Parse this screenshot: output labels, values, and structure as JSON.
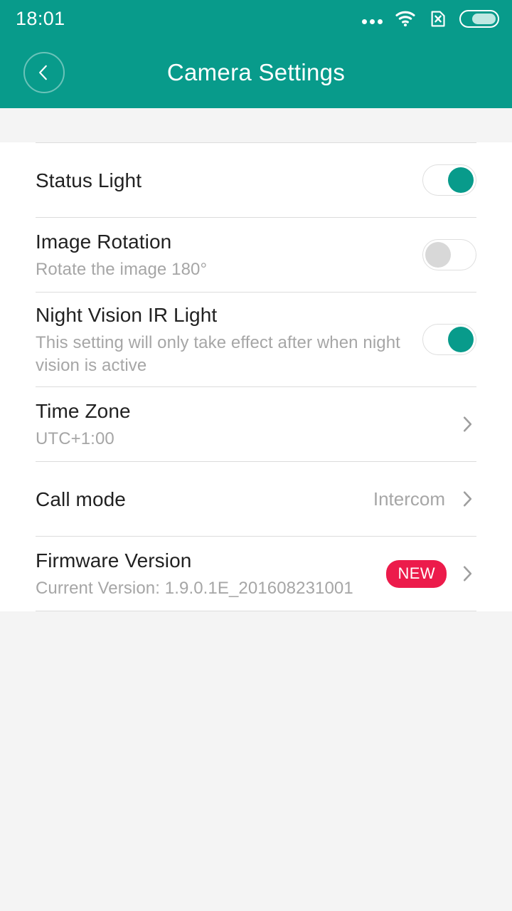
{
  "theme": {
    "accent": "#089b8b",
    "badge_color": "#ec1b4b",
    "page_bg": "#f4f4f4",
    "card_bg": "#ffffff"
  },
  "status_bar": {
    "time": "18:01",
    "icons": [
      "more-dots-icon",
      "wifi-icon",
      "sim-card-off-icon",
      "battery-icon"
    ],
    "battery_level_pct": 72
  },
  "app_bar": {
    "back_icon": "chevron-left-icon",
    "title": "Camera Settings"
  },
  "settings": {
    "rows": [
      {
        "id": "status-light",
        "title": "Status Light",
        "subtitle": "",
        "control": "toggle",
        "toggle_state": "on"
      },
      {
        "id": "image-rotation",
        "title": "Image Rotation",
        "subtitle": "Rotate the image 180°",
        "control": "toggle",
        "toggle_state": "off"
      },
      {
        "id": "night-vision-ir-light",
        "title": "Night Vision IR Light",
        "subtitle": "This setting will only take effect after when night vision is active",
        "control": "toggle",
        "toggle_state": "on"
      },
      {
        "id": "time-zone",
        "title": "Time Zone",
        "subtitle": "UTC+1:00",
        "control": "chevron",
        "value": ""
      },
      {
        "id": "call-mode",
        "title": "Call mode",
        "subtitle": "",
        "control": "chevron",
        "value": "Intercom"
      },
      {
        "id": "firmware-version",
        "title": "Firmware Version",
        "subtitle": "Current Version: 1.9.0.1E_201608231001",
        "control": "chevron",
        "value": "",
        "badge": "NEW"
      }
    ]
  }
}
